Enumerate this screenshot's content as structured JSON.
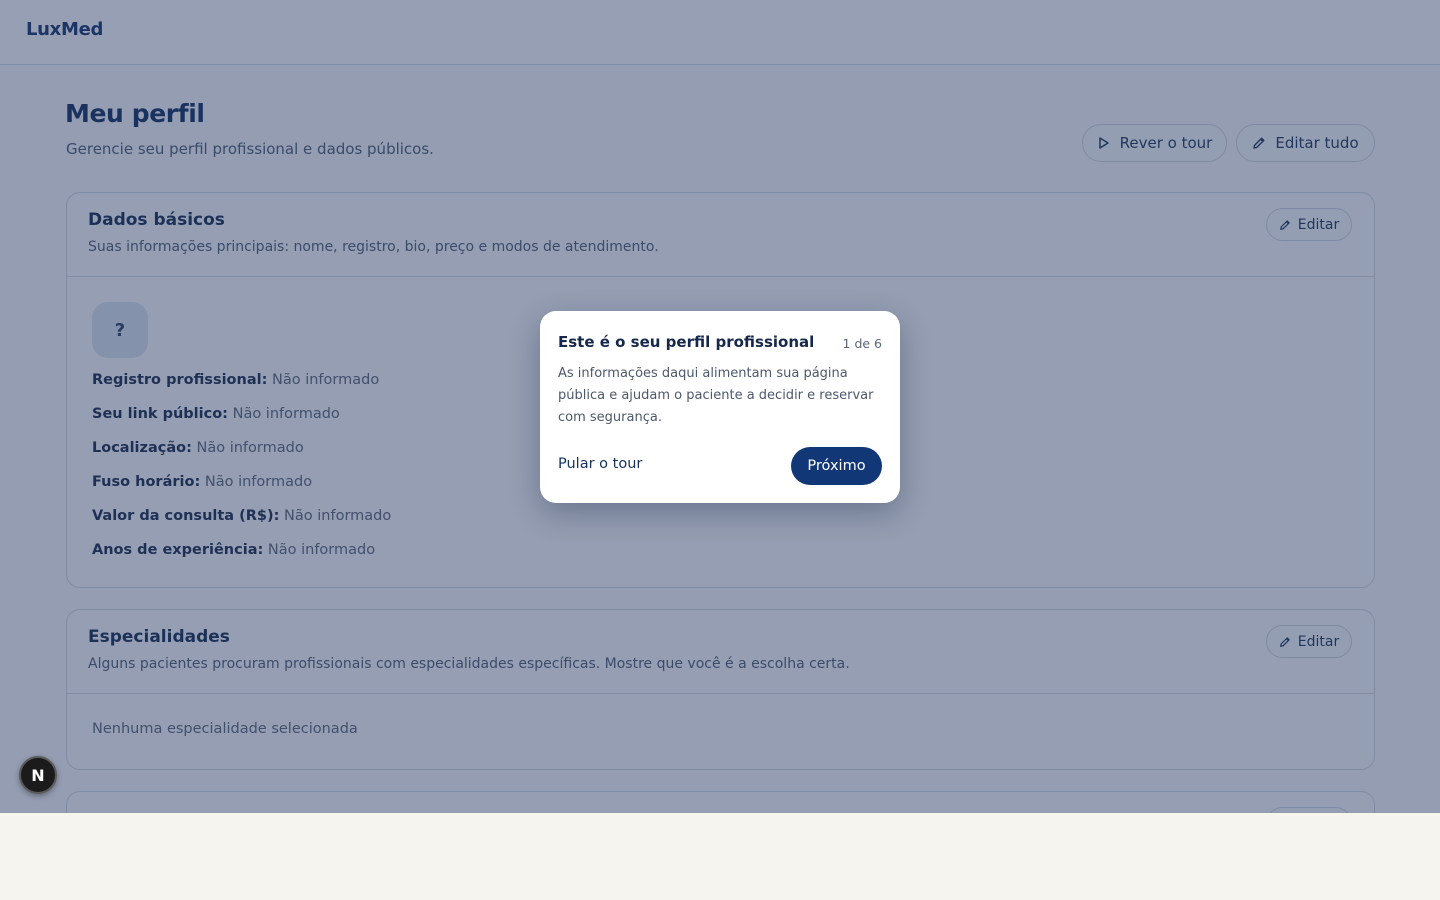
{
  "header": {
    "brand": "LuxMed"
  },
  "page": {
    "title": "Meu perfil",
    "subtitle": "Gerencie seu perfil profissional e dados públicos.",
    "actions": {
      "tour_label": "Rever o tour",
      "edit_all_label": "Editar tudo"
    }
  },
  "basic_data": {
    "title": "Dados básicos",
    "description": "Suas informações principais: nome, registro, bio, preço e modos de atendimento.",
    "edit_label": "Editar",
    "avatar_placeholder": "?",
    "fields": [
      {
        "label": "Registro profissional:",
        "value": "Não informado"
      },
      {
        "label": "Seu link público:",
        "value": "Não informado"
      },
      {
        "label": "Localização:",
        "value": "Não informado"
      },
      {
        "label": "Fuso horário:",
        "value": "Não informado"
      },
      {
        "label": "Valor da consulta (R$):",
        "value": "Não informado"
      },
      {
        "label": "Anos de experiência:",
        "value": "Não informado"
      }
    ]
  },
  "specialties": {
    "title": "Especialidades",
    "description": "Alguns pacientes procuram profissionais com especialidades específicas. Mostre que você é a escolha certa.",
    "edit_label": "Editar",
    "empty_text": "Nenhuma especialidade selecionada"
  },
  "tour": {
    "title": "Este é o seu perfil profissional",
    "step": "1 de 6",
    "body": "As informações daqui alimentam sua página pública e ajudam o paciente a decidir e reservar com segurança.",
    "skip_label": "Pular o tour",
    "next_label": "Próximo"
  },
  "dev_badge": {
    "label": "N"
  },
  "icons": {
    "tour": "play-icon",
    "edit": "pencil-icon"
  }
}
